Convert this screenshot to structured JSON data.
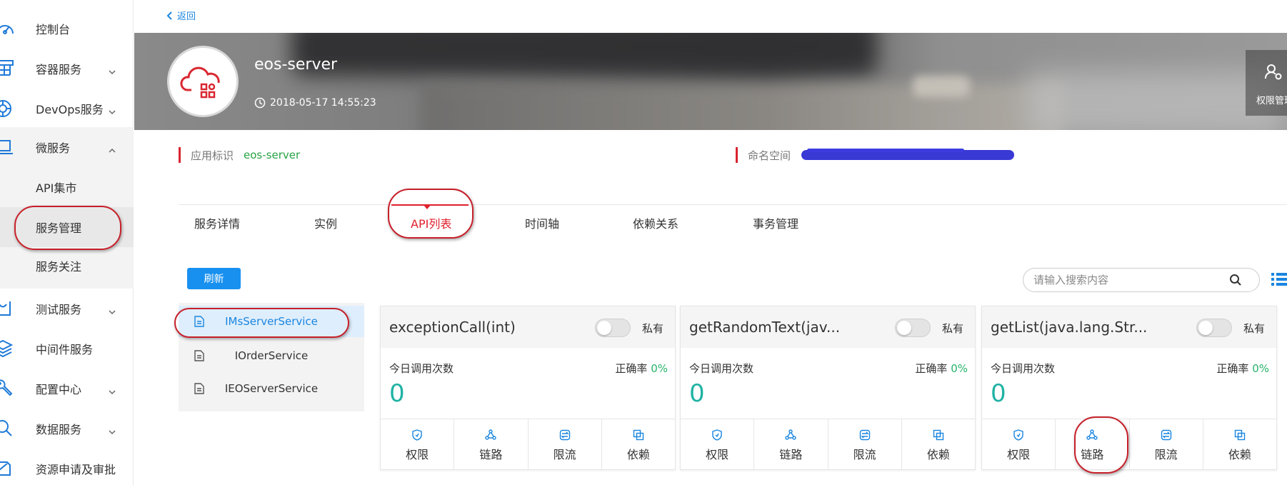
{
  "sidebar": {
    "items": [
      {
        "label": "控制台",
        "icon": "dashboard-icon",
        "has_chevron": false
      },
      {
        "label": "容器服务",
        "icon": "container-icon",
        "has_chevron": true
      },
      {
        "label": "DevOps服务",
        "icon": "devops-icon",
        "has_chevron": true
      },
      {
        "label": "微服务",
        "icon": "laptop-icon",
        "has_chevron": true,
        "expanded": true
      },
      {
        "label": "测试服务",
        "icon": "test-icon",
        "has_chevron": true
      },
      {
        "label": "中间件服务",
        "icon": "layers-icon",
        "has_chevron": false
      },
      {
        "label": "配置中心",
        "icon": "wrench-icon",
        "has_chevron": true
      },
      {
        "label": "数据服务",
        "icon": "search-data-icon",
        "has_chevron": true
      },
      {
        "label": "资源申请及审批",
        "icon": "approval-icon",
        "has_chevron": false
      }
    ],
    "submenu": [
      {
        "label": "API集市"
      },
      {
        "label": "服务管理",
        "active": true
      },
      {
        "label": "服务关注"
      }
    ]
  },
  "back_label": "返回",
  "app": {
    "name": "eos-server",
    "created_at": "2018-05-17 14:55:23",
    "permission_button": "权限管理"
  },
  "info": {
    "app_id_key": "应用标识",
    "app_id_value": "eos-server",
    "namespace_key": "命名空间"
  },
  "tabs": [
    {
      "label": "服务详情"
    },
    {
      "label": "实例"
    },
    {
      "label": "API列表",
      "active": true
    },
    {
      "label": "时间轴"
    },
    {
      "label": "依赖关系"
    },
    {
      "label": "事务管理"
    }
  ],
  "refresh_label": "刷新",
  "search": {
    "placeholder": "请输入搜索内容"
  },
  "services": [
    {
      "label": "IMsServerService",
      "active": true
    },
    {
      "label": "IOrderService"
    },
    {
      "label": "IEOServerService"
    }
  ],
  "cards": [
    {
      "name": "exceptionCall(int)",
      "private_label": "私有",
      "private_on": false,
      "calls_label": "今日调用次数",
      "rate_label": "正确率",
      "rate_value": "0%",
      "count": "0",
      "actions": [
        "权限",
        "链路",
        "限流",
        "依赖"
      ]
    },
    {
      "name": "getRandomText(jav...",
      "private_label": "私有",
      "private_on": false,
      "calls_label": "今日调用次数",
      "rate_label": "正确率",
      "rate_value": "0%",
      "count": "0",
      "actions": [
        "权限",
        "链路",
        "限流",
        "依赖"
      ]
    },
    {
      "name": "getList(java.lang.Str...",
      "private_label": "私有",
      "private_on": false,
      "calls_label": "今日调用次数",
      "rate_label": "正确率",
      "rate_value": "0%",
      "count": "0",
      "actions": [
        "权限",
        "链路",
        "限流",
        "依赖"
      ]
    }
  ],
  "colors": {
    "accent": "#1a86e0",
    "active_tab": "#e0202d",
    "success": "#27a344",
    "count": "#20b2a4",
    "annotation": "#c6202a"
  }
}
